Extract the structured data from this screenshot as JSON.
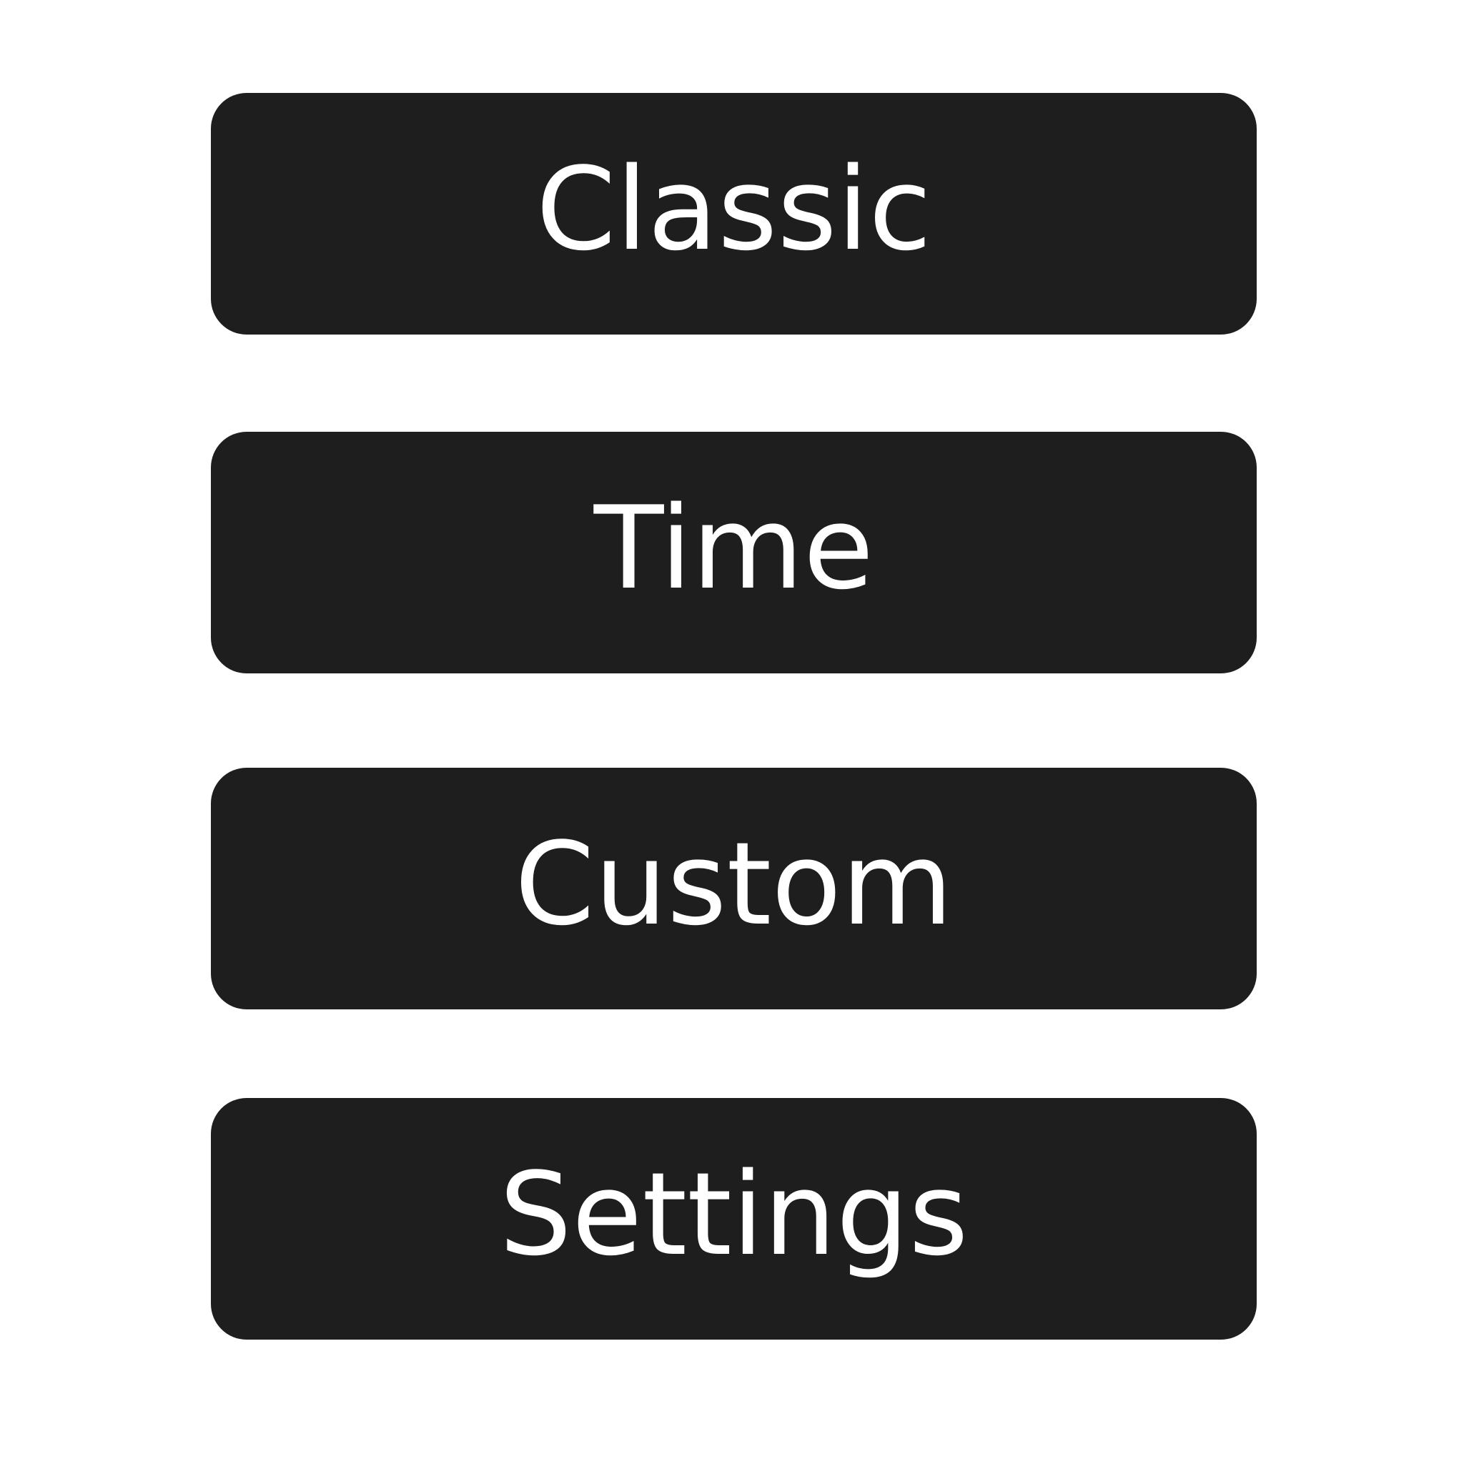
{
  "menu": {
    "items": [
      {
        "label": "Classic"
      },
      {
        "label": "Time"
      },
      {
        "label": "Custom"
      },
      {
        "label": "Settings"
      }
    ]
  },
  "colors": {
    "background": "#ffffff",
    "button_fill": "#1e1e1e",
    "button_text": "#ffffff"
  }
}
